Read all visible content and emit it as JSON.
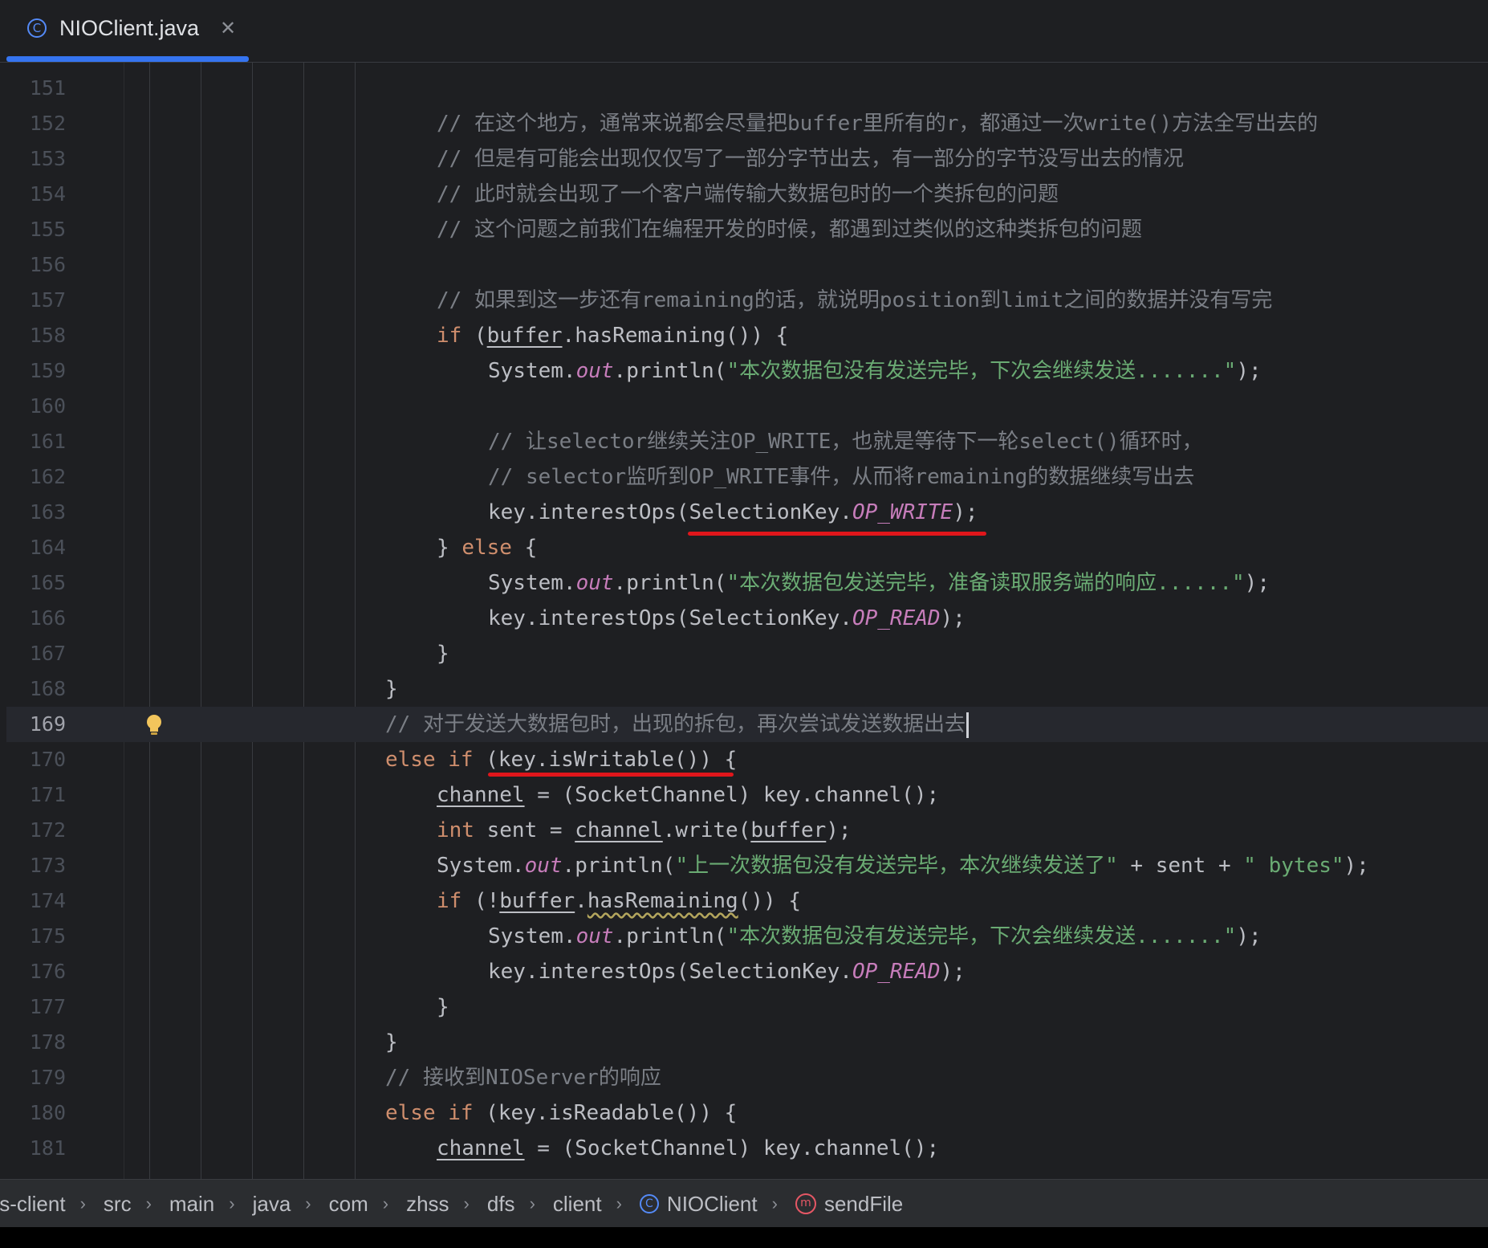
{
  "tab": {
    "title": "NIOClient.java",
    "icon": "class-icon",
    "icon_glyph": "C",
    "close_glyph": "✕"
  },
  "editor": {
    "current_line": 169,
    "lines": [
      {
        "num": "151",
        "indent": 0,
        "tokens": []
      },
      {
        "num": "152",
        "indent": 3,
        "tokens": [
          {
            "t": "// 在这个地方，通常来说都会尽量把buffer里所有的r，都通过一次write()方法全写出去的",
            "c": "cmt"
          }
        ]
      },
      {
        "num": "153",
        "indent": 3,
        "tokens": [
          {
            "t": "// 但是有可能会出现仅仅写了一部分字节出去，有一部分的字节没写出去的情况",
            "c": "cmt"
          }
        ]
      },
      {
        "num": "154",
        "indent": 3,
        "tokens": [
          {
            "t": "// 此时就会出现了一个客户端传输大数据包时的一个类拆包的问题",
            "c": "cmt"
          }
        ]
      },
      {
        "num": "155",
        "indent": 3,
        "tokens": [
          {
            "t": "// 这个问题之前我们在编程开发的时候，都遇到过类似的这种类拆包的问题",
            "c": "cmt"
          }
        ]
      },
      {
        "num": "156",
        "indent": 0,
        "tokens": []
      },
      {
        "num": "157",
        "indent": 3,
        "tokens": [
          {
            "t": "// 如果到这一步还有remaining的话，就说明position到limit之间的数据并没有写完",
            "c": "cmt"
          }
        ]
      },
      {
        "num": "158",
        "indent": 3,
        "tokens": [
          {
            "t": "if",
            "c": "kw"
          },
          {
            "t": " ("
          },
          {
            "t": "buffer",
            "c": "ul"
          },
          {
            "t": ".hasRemaining()) {"
          }
        ]
      },
      {
        "num": "159",
        "indent": 4,
        "tokens": [
          {
            "t": "System."
          },
          {
            "t": "out",
            "c": "fld"
          },
          {
            "t": ".println("
          },
          {
            "t": "\"本次数据包没有发送完毕，下次会继续发送.......\"",
            "c": "str"
          },
          {
            "t": ");"
          }
        ]
      },
      {
        "num": "160",
        "indent": 0,
        "tokens": []
      },
      {
        "num": "161",
        "indent": 4,
        "tokens": [
          {
            "t": "// 让selector继续关注OP_WRITE，也就是等待下一轮select()循环时，",
            "c": "cmt"
          }
        ]
      },
      {
        "num": "162",
        "indent": 4,
        "tokens": [
          {
            "t": "// selector监听到OP_WRITE事件，从而将remaining的数据继续写出去",
            "c": "cmt"
          }
        ]
      },
      {
        "num": "163",
        "indent": 4,
        "tokens": [
          {
            "t": "key.interestOps(SelectionKey."
          },
          {
            "t": "OP_WRITE",
            "c": "fld"
          },
          {
            "t": ");"
          }
        ]
      },
      {
        "num": "164",
        "indent": 3,
        "tokens": [
          {
            "t": "} "
          },
          {
            "t": "else",
            "c": "kw"
          },
          {
            "t": " {"
          }
        ]
      },
      {
        "num": "165",
        "indent": 4,
        "tokens": [
          {
            "t": "System."
          },
          {
            "t": "out",
            "c": "fld"
          },
          {
            "t": ".println("
          },
          {
            "t": "\"本次数据包发送完毕，准备读取服务端的响应......\"",
            "c": "str"
          },
          {
            "t": ");"
          }
        ]
      },
      {
        "num": "166",
        "indent": 4,
        "tokens": [
          {
            "t": "key.interestOps(SelectionKey."
          },
          {
            "t": "OP_READ",
            "c": "fld"
          },
          {
            "t": ");"
          }
        ]
      },
      {
        "num": "167",
        "indent": 3,
        "tokens": [
          {
            "t": "}"
          }
        ]
      },
      {
        "num": "168",
        "indent": 2,
        "tokens": [
          {
            "t": "}"
          }
        ]
      },
      {
        "num": "169",
        "indent": 2,
        "tokens": [
          {
            "t": "// 对于发送大数据包时，出现的拆包，再次尝试发送数据出去",
            "c": "cmt"
          }
        ]
      },
      {
        "num": "170",
        "indent": 2,
        "tokens": [
          {
            "t": "else if",
            "c": "kw"
          },
          {
            "t": " (key.isWritable()) {"
          }
        ]
      },
      {
        "num": "171",
        "indent": 3,
        "tokens": [
          {
            "t": "channel",
            "c": "ul"
          },
          {
            "t": " = (SocketChannel) key.channel();"
          }
        ]
      },
      {
        "num": "172",
        "indent": 3,
        "tokens": [
          {
            "t": "int",
            "c": "kw"
          },
          {
            "t": " sent = "
          },
          {
            "t": "channel",
            "c": "ul"
          },
          {
            "t": ".write("
          },
          {
            "t": "buffer",
            "c": "ul"
          },
          {
            "t": ");"
          }
        ]
      },
      {
        "num": "173",
        "indent": 3,
        "tokens": [
          {
            "t": "System."
          },
          {
            "t": "out",
            "c": "fld"
          },
          {
            "t": ".println("
          },
          {
            "t": "\"上一次数据包没有发送完毕，本次继续发送了\"",
            "c": "str"
          },
          {
            "t": " + sent + "
          },
          {
            "t": "\" bytes\"",
            "c": "str"
          },
          {
            "t": ");"
          }
        ]
      },
      {
        "num": "174",
        "indent": 3,
        "tokens": [
          {
            "t": "if",
            "c": "kw"
          },
          {
            "t": " (!"
          },
          {
            "t": "buffer",
            "c": "ul"
          },
          {
            "t": "."
          },
          {
            "t": "hasRemaining",
            "c": "wavy"
          },
          {
            "t": "()) {"
          }
        ]
      },
      {
        "num": "175",
        "indent": 4,
        "tokens": [
          {
            "t": "System."
          },
          {
            "t": "out",
            "c": "fld"
          },
          {
            "t": ".println("
          },
          {
            "t": "\"本次数据包没有发送完毕，下次会继续发送.......\"",
            "c": "str"
          },
          {
            "t": ");"
          }
        ]
      },
      {
        "num": "176",
        "indent": 4,
        "tokens": [
          {
            "t": "key.interestOps(SelectionKey."
          },
          {
            "t": "OP_READ",
            "c": "fld"
          },
          {
            "t": ");"
          }
        ]
      },
      {
        "num": "177",
        "indent": 3,
        "tokens": [
          {
            "t": "}"
          }
        ]
      },
      {
        "num": "178",
        "indent": 2,
        "tokens": [
          {
            "t": "}"
          }
        ]
      },
      {
        "num": "179",
        "indent": 2,
        "tokens": [
          {
            "t": "// 接收到NIOServer的响应",
            "c": "cmt"
          }
        ]
      },
      {
        "num": "180",
        "indent": 2,
        "tokens": [
          {
            "t": "else if",
            "c": "kw"
          },
          {
            "t": " (key.isReadable()) {"
          }
        ]
      },
      {
        "num": "181",
        "indent": 3,
        "tokens": [
          {
            "t": "channel",
            "c": "ul"
          },
          {
            "t": " = (SocketChannel) key.channel();"
          }
        ]
      }
    ]
  },
  "annotations": {
    "color": "#e0161b",
    "marks": [
      {
        "line": "163",
        "note": "red underline under SelectionKey.OP_WRITE"
      },
      {
        "line": "170",
        "note": "red underline under (key.isWritable())"
      }
    ]
  },
  "breadcrumb": {
    "items": [
      {
        "label": "fs-client",
        "icon": ""
      },
      {
        "label": "src",
        "icon": ""
      },
      {
        "label": "main",
        "icon": ""
      },
      {
        "label": "java",
        "icon": ""
      },
      {
        "label": "com",
        "icon": ""
      },
      {
        "label": "zhss",
        "icon": ""
      },
      {
        "label": "dfs",
        "icon": ""
      },
      {
        "label": "client",
        "icon": ""
      },
      {
        "label": "NIOClient",
        "icon": "class-icon"
      },
      {
        "label": "sendFile",
        "icon": "method-icon"
      }
    ],
    "separator": "›"
  },
  "colors": {
    "background": "#1e1f22",
    "keyword": "#cf8e6d",
    "string": "#6aab73",
    "comment": "#7a7e85",
    "static_field": "#c77dbb",
    "text": "#bcbec4",
    "accent": "#3574f0"
  }
}
